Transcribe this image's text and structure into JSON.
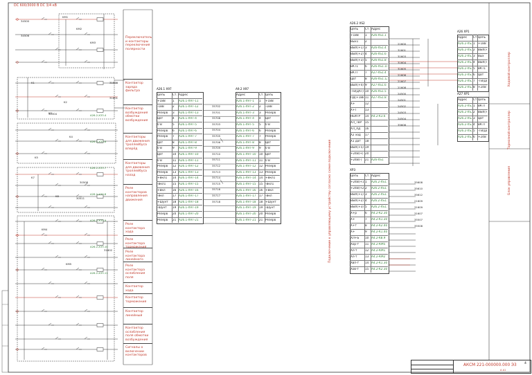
{
  "sheet": {
    "header": "DC 600/3000 В DC 3/4 кВ",
    "title": "АКСМ 221-000000.000 Э3",
    "sheet_label": "А А1",
    "page_no": "4"
  },
  "legend_blocks": [
    "Переключатель и контакторы переключения полярности",
    "Контактор заряда фильтра",
    "Контактор возбуждения обмотки возбуждения",
    "Контакторы для движения троллейбуса вперёд",
    "Контакторы для движения троллейбуса назад",
    "Реле контакторов направления движения",
    "Реле контактора хода",
    "Реле контактора торможения",
    "Реле контактора линейного",
    "Реле контактора ослабления поля",
    "Контактор хода",
    "Контактор торможения",
    "Контактор линейный",
    "Контактор ослабления поля обмотки возбуждения",
    "Сигналы о включении контакторов"
  ],
  "vertical_note": "Подключение к управляющему устройству согласно схеме подключения",
  "right_side_notes": [
    "Блок управления",
    "Тормозной контроллер",
    "Ходовой контроллер"
  ],
  "left_labels": {
    "tags": [
      "KМ1",
      "KМ2",
      "KМ3",
      "K1",
      "K2",
      "K3",
      "K4",
      "K5",
      "K7",
      "K8",
      "KМ4",
      "KМ5"
    ],
    "wires": [
      "34500",
      "34506",
      "31600",
      "31601",
      "35304",
      "30508",
      "30511",
      "31602"
    ],
    "refs": [
      "A26.2-X33.4",
      "A26.2-X33.6",
      "A26.2-X33.7",
      "A26.2-X33.8",
      "A26.2-X33.9",
      "A26.2-X33.10",
      "A26.2-X33.11"
    ]
  },
  "tables": {
    "x97": {
      "title": "A26.1 X97",
      "headers": [
        "Цепь",
        "Ст.",
        "Адрес"
      ],
      "rows": [
        [
          "+18В",
          "1",
          "A26.1-X97-11"
        ],
        [
          "-18В",
          "2",
          "A26.1-X97-12"
        ],
        [
          "Резерв",
          "3",
          "A26.1-X97-13"
        ],
        [
          "Цвт",
          "4",
          "A26.1-X97-4"
        ],
        [
          "0 В",
          "5",
          "A26.1-X97-5"
        ],
        [
          "Резерв",
          "6",
          "A26.1-X97-6"
        ],
        [
          "Резерв",
          "7",
          "A26.1-X97-7"
        ],
        [
          "Цвт",
          "8",
          "A26.1-X97-8"
        ],
        [
          "0 В",
          "9",
          "A26.1-X97-9"
        ],
        [
          "Цвт",
          "10",
          "A26.1-X97-10"
        ],
        [
          "0 В",
          "11",
          "A26.1-X97-11"
        ],
        [
          "Резерв",
          "12",
          "A26.1-X97-12"
        ],
        [
          "Резерв",
          "13",
          "A26.1-X97-13"
        ],
        [
          "+Вкл1",
          "14",
          "A26.1-X97-14"
        ],
        [
          "-Вкл1",
          "15",
          "A26.1-X97-15"
        ],
        [
          "+Вкл",
          "16",
          "A26.1-X97-16"
        ],
        [
          "-Вкл",
          "17",
          "A26.1-X97-17"
        ],
        [
          "+Шунт",
          "18",
          "A26.1-X97-18"
        ],
        [
          "-Шунт",
          "19",
          "A26.1-X97-19"
        ],
        [
          "Резерв",
          "20",
          "A26.1-X97-20"
        ],
        [
          "Резерв",
          "21",
          "A26.1-X97-21"
        ]
      ]
    },
    "x97b": {
      "title": "A9.2 X97",
      "headers": [
        "Адрес",
        "Ст.",
        "Цепь"
      ],
      "rows": [
        [
          "A26.1-X97-1",
          "1",
          "+18В"
        ],
        [
          "A26.1-X97-2",
          "2",
          "-18В"
        ],
        [
          "A26.1-X97-3",
          "3",
          "Резерв"
        ],
        [
          "A26.1-X97-4",
          "4",
          "Цвт"
        ],
        [
          "A26.1-X97-5",
          "5",
          "0 В"
        ],
        [
          "A26.1-X97-6",
          "6",
          "Резерв"
        ],
        [
          "A26.1-X97-7",
          "7",
          "Резерв"
        ],
        [
          "A26.1-X97-8",
          "8",
          "Цвт"
        ],
        [
          "A26.1-X97-9",
          "9",
          "0 В"
        ],
        [
          "A26.1-X97-10",
          "10",
          "Цвт"
        ],
        [
          "A26.1-X97-11",
          "11",
          "0 В"
        ],
        [
          "A26.1-X97-12",
          "12",
          "Резерв"
        ],
        [
          "A26.1-X97-13",
          "13",
          "Резерв"
        ],
        [
          "A26.1-X97-14",
          "14",
          "+Вкл1"
        ],
        [
          "A26.1-X97-15",
          "15",
          "-Вкл1"
        ],
        [
          "A26.1-X97-16",
          "16",
          "+Вкл"
        ],
        [
          "A26.1-X97-17",
          "17",
          "-Вкл"
        ],
        [
          "A26.1-X97-18",
          "18",
          "+Шунт"
        ],
        [
          "A26.1-X97-19",
          "19",
          "-Шунт"
        ],
        [
          "A26.1-X97-20",
          "20",
          "Резерв"
        ],
        [
          "A26.1-X97-21",
          "21",
          "Резерв"
        ]
      ]
    },
    "xs2": {
      "title": "A26.2 XS2",
      "headers": [
        "Цепь",
        "Ст.",
        "Адрес"
      ],
      "rows": [
        [
          "+18В",
          "1",
          "A26-XS1.1"
        ],
        [
          "Вых1",
          "2",
          ""
        ],
        [
          "ВЫХ(+1)",
          "3",
          "A26-XS1.4"
        ],
        [
          "ВЫХ(+2)",
          "4",
          "A26-XS1.6"
        ],
        [
          "ВЫХ(+3)",
          "5",
          "A26-XS1.8"
        ],
        [
          "ВКТ1",
          "6",
          "A26-XS1.10"
        ],
        [
          "ВКТТ",
          "7",
          "A27-XS1.4"
        ],
        [
          "Цвт",
          "8",
          "A26-XS1.12"
        ],
        [
          "ВЫХ(+4)",
          "9",
          "A27-XS1.6"
        ],
        [
          "-ТВ(ДАТ)",
          "10",
          "A26-XS1.5"
        ],
        [
          "ПД(+18В)",
          "11",
          "A27-XS1.8"
        ],
        [
          "Х+",
          "12",
          ""
        ],
        [
          "Х+Т",
          "13",
          ""
        ],
        [
          "НЕЙТР",
          "14",
          "A4.2-K3.6"
        ],
        [
          "ХЛ_ТВР",
          "15",
          ""
        ],
        [
          "ХЛ_ХД",
          "16",
          ""
        ],
        [
          "Х2 ход",
          "17",
          ""
        ],
        [
          "Х1 дат",
          "18",
          ""
        ],
        [
          "ВЫХ(+5)",
          "19",
          ""
        ],
        [
          "+24В(+)",
          "20",
          ""
        ],
        [
          "+24В(-)",
          "21",
          "A26-XS1"
        ]
      ]
    },
    "xp3": {
      "title": "XP3",
      "headers": [
        "Цепь",
        "Ст.",
        "Адрес"
      ],
      "rows": [
        [
          "+24В(+1)",
          "1",
          "A26.2-XS1.2"
        ],
        [
          "+24В(+2)",
          "2",
          "A26.2-XS1.2"
        ],
        [
          "ВЫХ(+1)",
          "3",
          "A26.2-XS1.2"
        ],
        [
          "ВЫХ(+2)",
          "4",
          "A26.2-XS1.2"
        ],
        [
          "ВЫХ(+3)",
          "5",
          "A26.2-XS1.2"
        ],
        [
          "Х+р",
          "6",
          "A4.2-K2.30"
        ],
        [
          "Х+",
          "7",
          "A4.2-K1.30"
        ],
        [
          "Х+т",
          "8",
          "A4.2-K2.40"
        ],
        [
          "Х+",
          "9",
          "A4.2-K1.40"
        ],
        [
          "ХЛ+Б",
          "10",
          "A4.2-K8.9"
        ],
        [
          "Хор-т",
          "11",
          "A4.2-КМ5"
        ],
        [
          "Хл-т",
          "12",
          "A4.2-КМ1"
        ],
        [
          "Хл-т",
          "13",
          "A4.2-КМ2"
        ],
        [
          "Хвп-т",
          "14",
          "A4.2-K1.30"
        ],
        [
          "Хов-т",
          "15",
          "A4.2-K2.30"
        ]
      ]
    },
    "xp1a": {
      "title": "A26 XP1",
      "headers": [
        "Адрес",
        "Ст.",
        "Цепь"
      ],
      "rows": [
        [
          "A26.2-XS2.1",
          "1",
          "+18В"
        ],
        [
          "A26.2-XS2.3",
          "2",
          "ВЫХ(+1)"
        ],
        [
          "A26.2-XS2.4",
          "3",
          "Вых"
        ],
        [
          "A26.2-XS2.5",
          "4",
          "ВЫХ(+2)"
        ],
        [
          "A26.2-XS2.6",
          "5",
          "ВКТ1"
        ],
        [
          "A26.2-XS2.8",
          "6",
          "Цвт"
        ],
        [
          "A26.2-XS2.10",
          "7",
          "-ТВ(ДАТ)"
        ],
        [
          "A26.2-XS2.11",
          "8",
          "+24В"
        ]
      ]
    },
    "xp1b": {
      "title": "A27 XP1",
      "headers": [
        "Адрес",
        "Ст.",
        "Цепь"
      ],
      "rows": [
        [
          "A26.2-XS2.7",
          "1",
          "ВКТТ"
        ],
        [
          "A26.2-XS2.9",
          "2",
          "ВЫХ(+4)"
        ],
        [
          "A26.2-XS2.11",
          "3",
          "Цвт"
        ],
        [
          "A26.2-XS2.12",
          "4",
          "ВКТТ"
        ],
        [
          "A26.2-XS2.13",
          "5",
          "-ТВ(ДАТ)"
        ],
        [
          "A26.2-XS2.14",
          "6",
          "+24В"
        ]
      ]
    }
  },
  "mid_wires": [
    "35702",
    "35701",
    "35708",
    "35703",
    "35704",
    "35705",
    "35706",
    "35709",
    "35710",
    "35711",
    "35712",
    "35713",
    "35714",
    "35715",
    "35716",
    "35717",
    "35718"
  ],
  "right_wires": [
    "21600",
    "31601",
    "31603",
    "31604",
    "31605",
    "21606",
    "21607",
    "21608",
    "24500",
    "24501",
    "24502",
    "24503",
    "24504",
    "35606",
    "35608",
    "35610",
    "35612",
    "21609",
    "31609",
    "31607",
    "35507",
    "35508"
  ]
}
